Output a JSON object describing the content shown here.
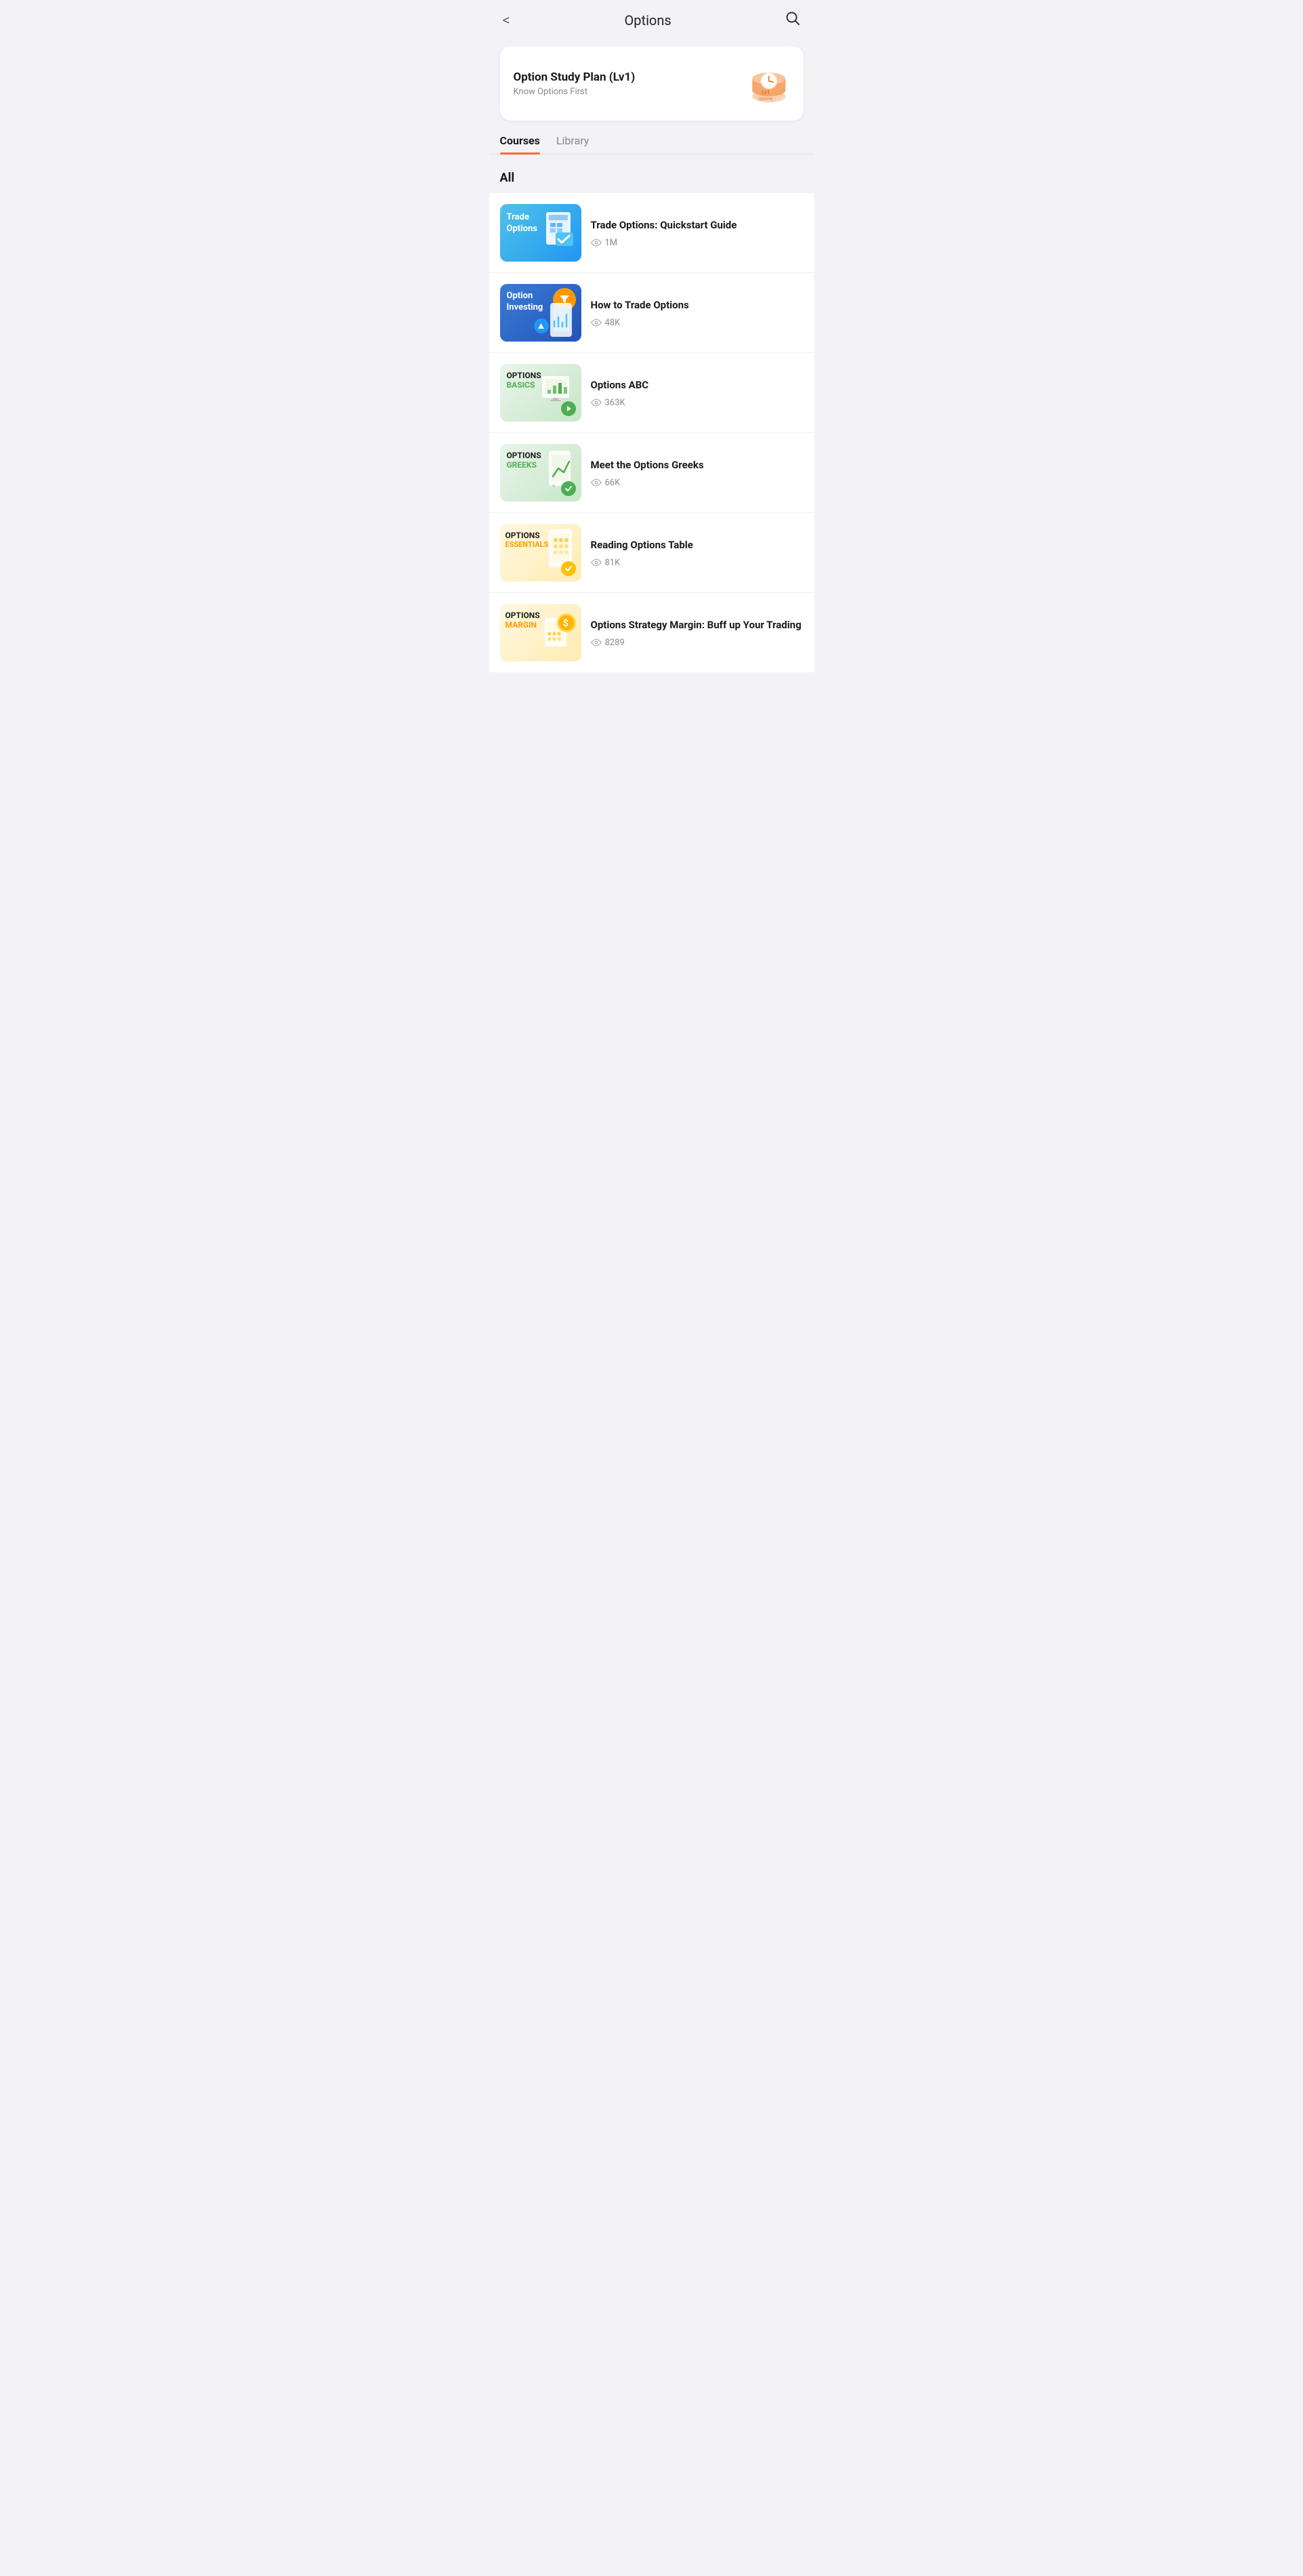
{
  "header": {
    "title": "Options",
    "back_label": "<",
    "search_label": "⌕"
  },
  "study_plan": {
    "title": "Option Study Plan (Lv1)",
    "subtitle": "Know Options First"
  },
  "tabs": [
    {
      "id": "courses",
      "label": "Courses",
      "active": true
    },
    {
      "id": "library",
      "label": "Library",
      "active": false
    }
  ],
  "section_label": "All",
  "courses": [
    {
      "id": 1,
      "title": "Trade Options: Quickstart Guide",
      "views": "1M",
      "thumb_type": "trade"
    },
    {
      "id": 2,
      "title": "How to Trade Options",
      "views": "48K",
      "thumb_type": "invest"
    },
    {
      "id": 3,
      "title": "Options ABC",
      "views": "363K",
      "thumb_type": "basics"
    },
    {
      "id": 4,
      "title": "Meet the Options Greeks",
      "views": "66K",
      "thumb_type": "greeks"
    },
    {
      "id": 5,
      "title": "Reading Options Table",
      "views": "81K",
      "thumb_type": "essentials"
    },
    {
      "id": 6,
      "title": "Options Strategy Margin: Buff up Your Trading",
      "views": "8289",
      "thumb_type": "margin"
    }
  ]
}
